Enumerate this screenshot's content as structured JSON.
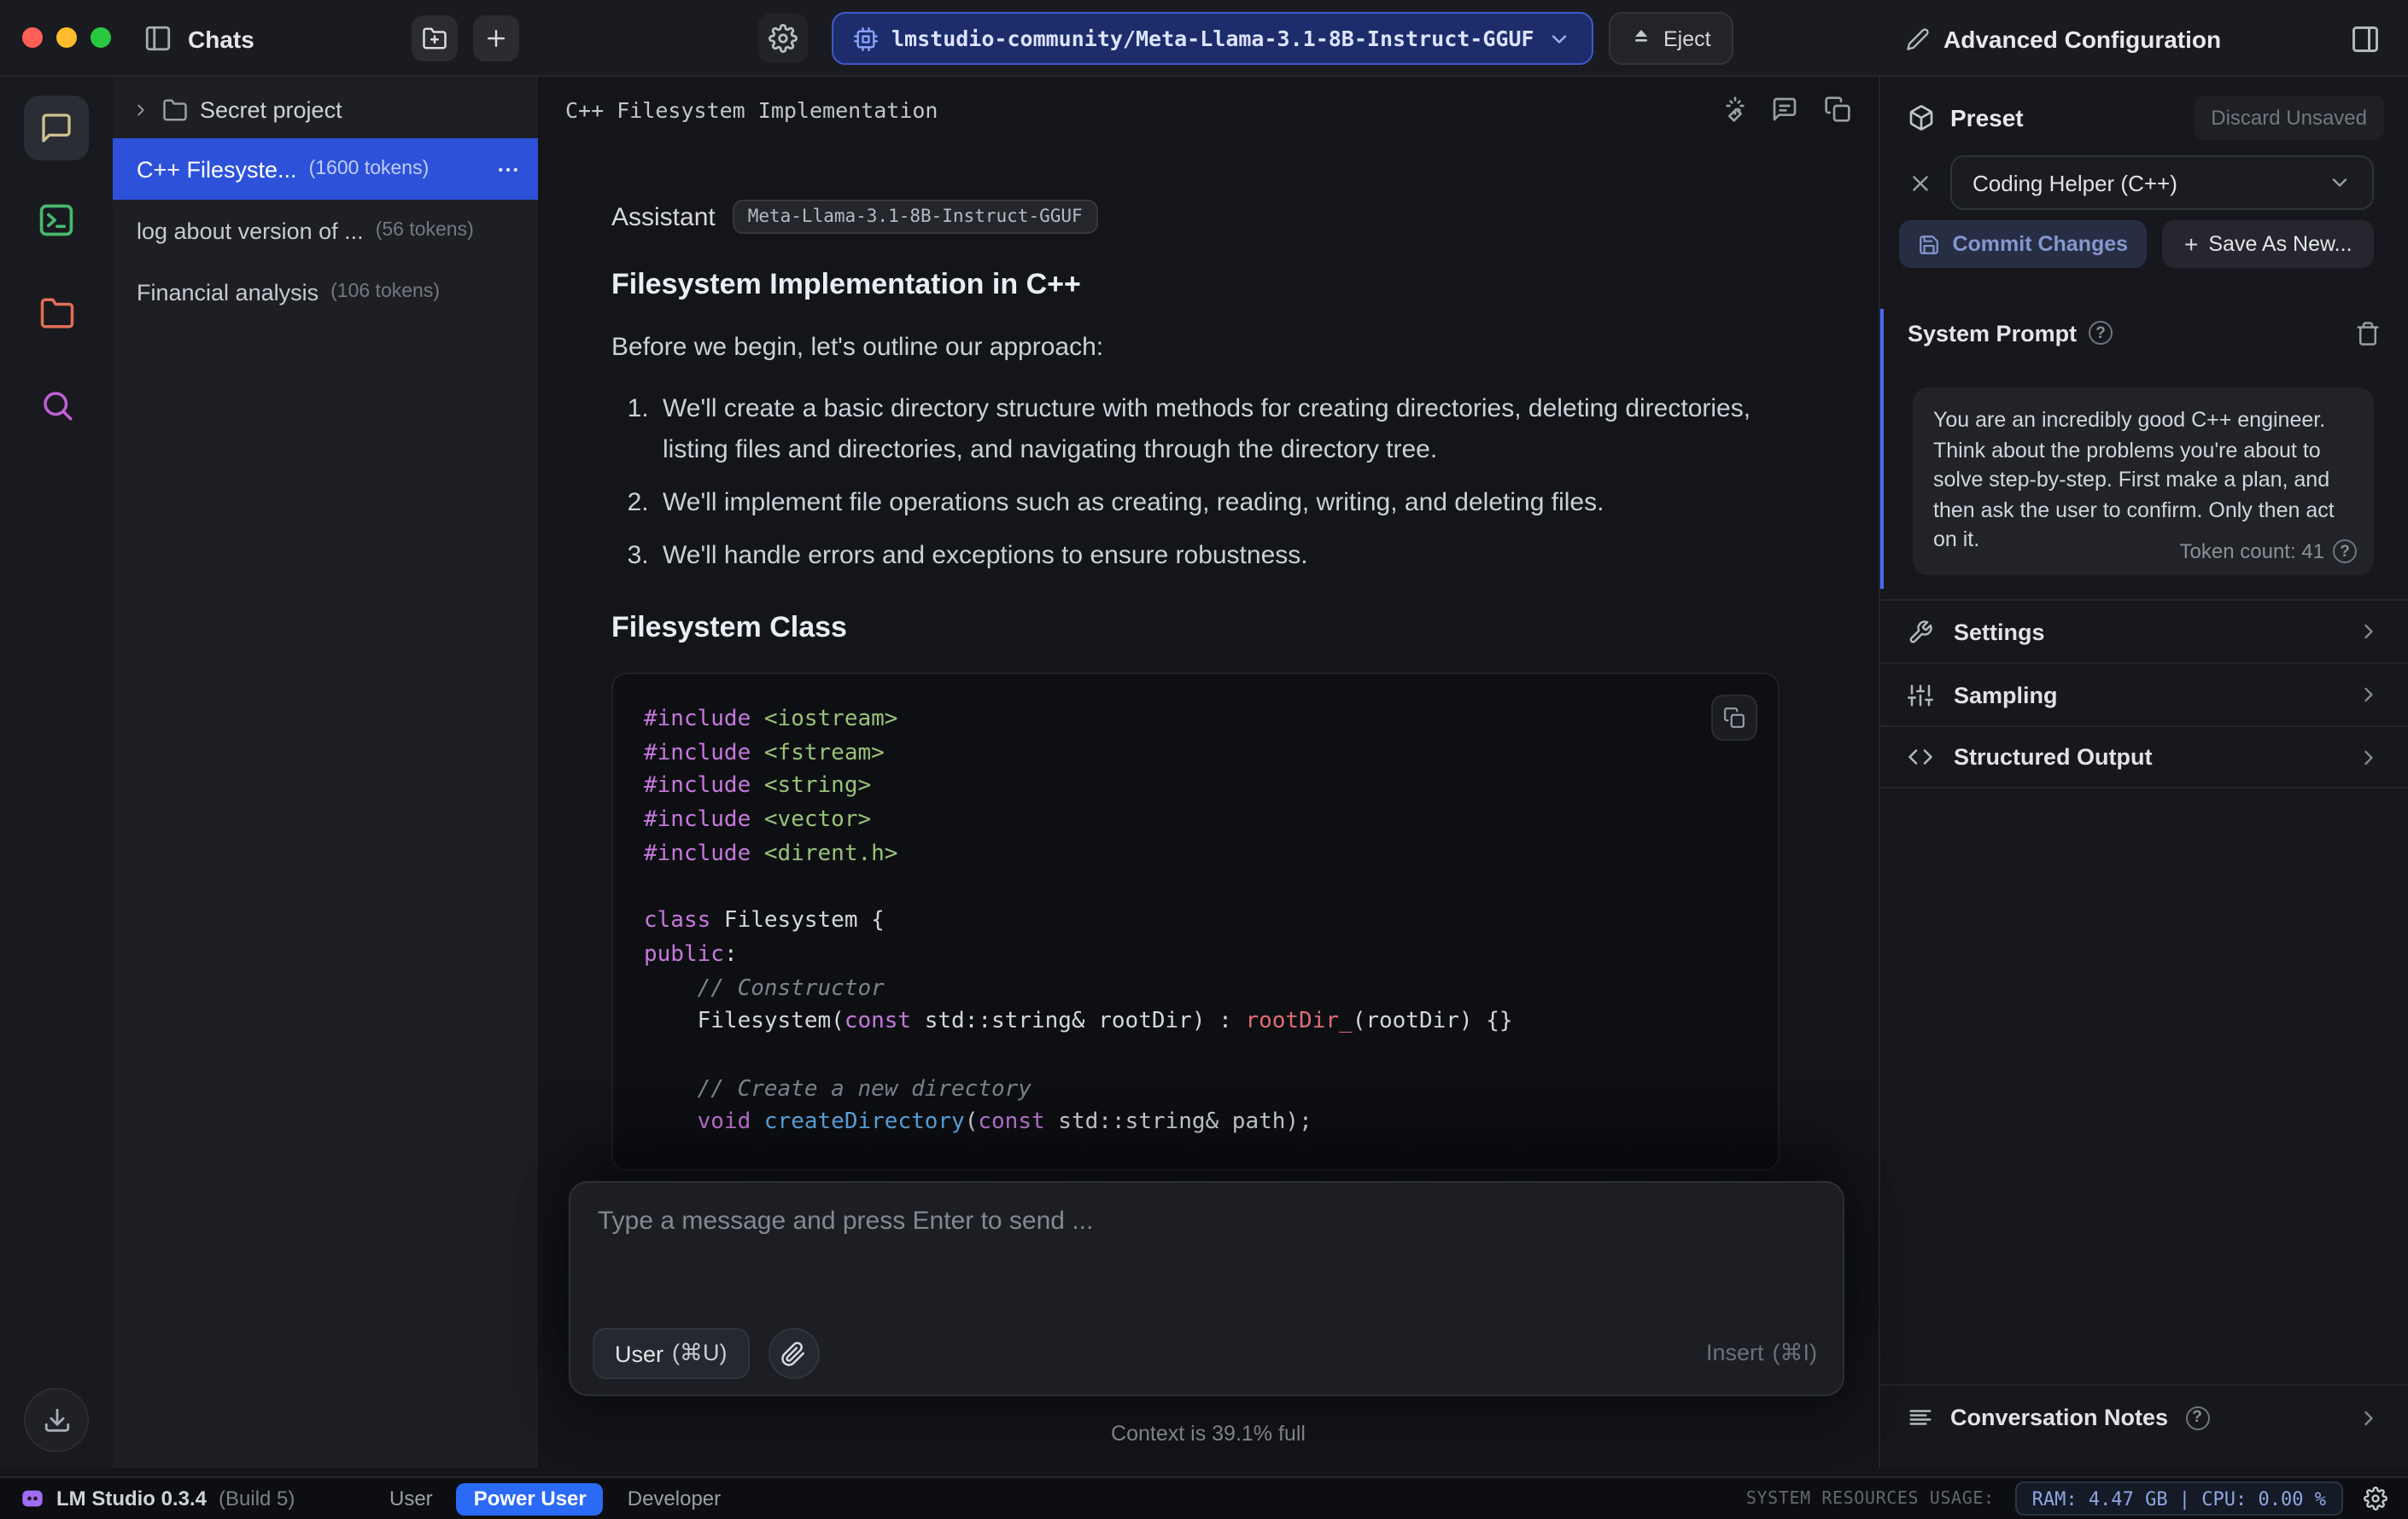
{
  "titlebar": {
    "chats_label": "Chats",
    "model_name": "lmstudio-community/Meta-Llama-3.1-8B-Instruct-GGUF",
    "eject_label": "Eject",
    "advanced_title": "Advanced Configuration"
  },
  "sidebar": {
    "folder_name": "Secret project",
    "chats": [
      {
        "title": "C++ Filesyste...",
        "tokens": "(1600 tokens)"
      },
      {
        "title": "log about version of ...",
        "tokens": "(56 tokens)"
      },
      {
        "title": "Financial analysis",
        "tokens": "(106 tokens)"
      }
    ]
  },
  "chat": {
    "title": "C++ Filesystem Implementation",
    "role_label": "Assistant",
    "model_badge": "Meta-Llama-3.1-8B-Instruct-GGUF",
    "heading_main": "Filesystem Implementation in C++",
    "intro": "Before we begin, let's outline our approach:",
    "steps": [
      "We'll create a basic directory structure with methods for creating directories, deleting directories, listing files and directories, and navigating through the directory tree.",
      "We'll implement file operations such as creating, reading, writing, and deleting files.",
      "We'll handle errors and exceptions to ensure robustness."
    ],
    "heading_code": "Filesystem Class",
    "code_lines": [
      [
        [
          "kw",
          "#include "
        ],
        [
          "str",
          "<iostream>"
        ]
      ],
      [
        [
          "kw",
          "#include "
        ],
        [
          "str",
          "<fstream>"
        ]
      ],
      [
        [
          "kw",
          "#include "
        ],
        [
          "str",
          "<string>"
        ]
      ],
      [
        [
          "kw",
          "#include "
        ],
        [
          "str",
          "<vector>"
        ]
      ],
      [
        [
          "kw",
          "#include "
        ],
        [
          "str",
          "<dirent.h>"
        ]
      ],
      [],
      [
        [
          "kw",
          "class"
        ],
        [
          "pln",
          " Filesystem {"
        ]
      ],
      [
        [
          "kw",
          "public"
        ],
        [
          "pln",
          ":"
        ]
      ],
      [
        [
          "cmt",
          "    // Constructor"
        ]
      ],
      [
        [
          "pln",
          "    Filesystem("
        ],
        [
          "kw",
          "const"
        ],
        [
          "pln",
          " std::string& rootDir) : "
        ],
        [
          "var",
          "rootDir_"
        ],
        [
          "pln",
          "(rootDir) {}"
        ]
      ],
      [],
      [
        [
          "cmt",
          "    // Create a new directory"
        ]
      ],
      [
        [
          "pln",
          "    "
        ],
        [
          "kw",
          "void"
        ],
        [
          "pln",
          " "
        ],
        [
          "fn",
          "createDirectory"
        ],
        [
          "pln",
          "("
        ],
        [
          "kw",
          "const"
        ],
        [
          "pln",
          " std::string& path);"
        ]
      ]
    ]
  },
  "composer": {
    "placeholder": "Type a message and press Enter to send ...",
    "role_button": "User",
    "role_shortcut": "(⌘U)",
    "insert_label": "Insert",
    "insert_shortcut": "(⌘I)",
    "context_status": "Context is 39.1% full"
  },
  "config": {
    "preset_label": "Preset",
    "discard_label": "Discard Unsaved",
    "preset_value": "Coding Helper (C++)",
    "commit_label": "Commit Changes",
    "save_new_plus": "+",
    "save_new_label": "Save As New...",
    "system_prompt_label": "System Prompt",
    "system_prompt_text": "You are an incredibly good C++ engineer. Think about the problems you're about to solve step-by-step. First make a plan, and then ask the user to confirm. Only then act on it.",
    "token_count": "Token count: 41",
    "help_glyph": "?",
    "sections": [
      "Settings",
      "Sampling",
      "Structured Output"
    ],
    "notes_label": "Conversation Notes"
  },
  "statusbar": {
    "app_name": "LM Studio 0.3.4",
    "build": "(Build 5)",
    "modes": [
      "User",
      "Power User",
      "Developer"
    ],
    "resources_label": "SYSTEM RESOURCES USAGE:",
    "resources_value": "RAM: 4.47 GB  |  CPU: 0.00 %"
  }
}
